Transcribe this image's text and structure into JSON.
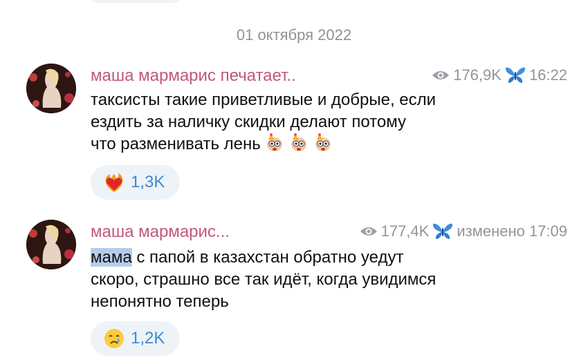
{
  "date_separator": "01 октября 2022",
  "messages": [
    {
      "author": "маша мармарис печатает..",
      "views": "176,9K",
      "time": "16:22",
      "lines": [
        "таксисты такие приветливые и добрые, если",
        "ездить за наличку скидки делают  потому",
        "что разменивать лень"
      ],
      "emoji_icons": [
        "party-face-sticker-icon",
        "party-face-sticker-icon",
        "party-face-sticker-icon"
      ],
      "reaction": {
        "icon": "heart-on-fire-icon",
        "count": "1,3K"
      }
    },
    {
      "author": "маша мармарис...",
      "views": "177,4K",
      "edited_time": "изменено 17:09",
      "highlighted_word": "мама",
      "lines": [
        " с папой в казахстан обратно уедут",
        "скоро, страшно все так идёт, когда увидимся",
        "непонятно теперь"
      ],
      "reaction": {
        "icon": "crying-face-icon",
        "count": "1,2K"
      }
    }
  ],
  "colors": {
    "author": "#c1587b",
    "meta": "#8f959a",
    "reaction_bg": "#eef3f8",
    "reaction_text": "#3d88d4",
    "selection": "#b5ccec"
  }
}
